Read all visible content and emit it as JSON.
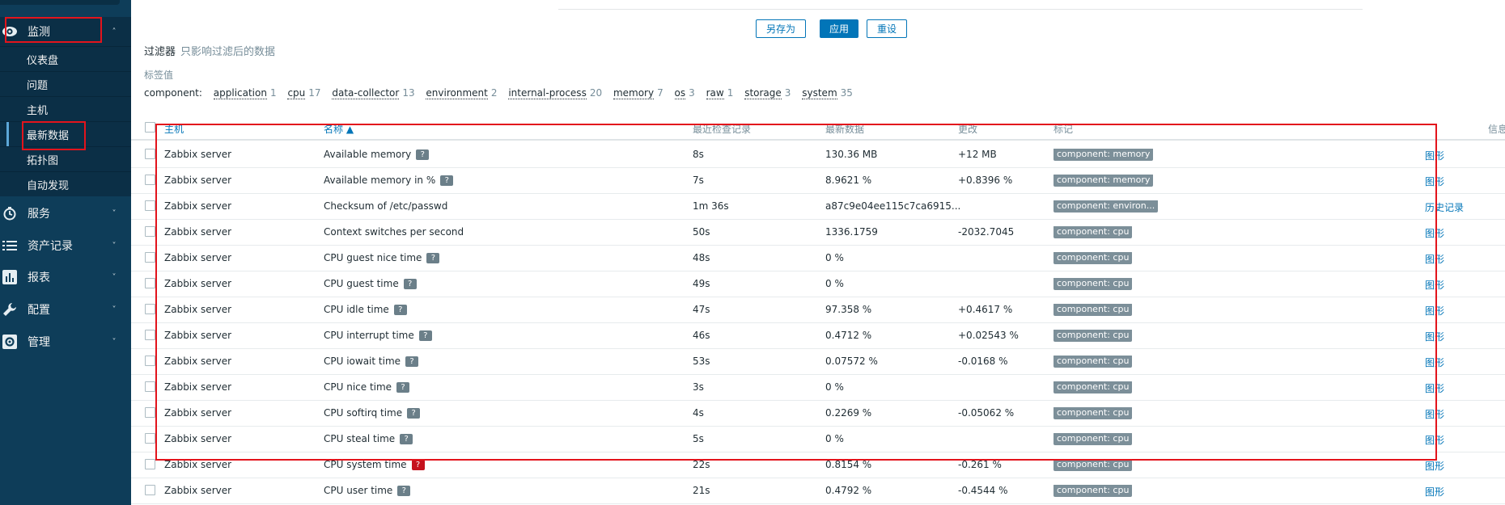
{
  "sidebar": {
    "items": [
      {
        "label": "监测",
        "icon": "eye-icon",
        "expanded": true
      },
      {
        "label": "服务",
        "icon": "clock-icon"
      },
      {
        "label": "资产记录",
        "icon": "list-icon"
      },
      {
        "label": "报表",
        "icon": "bar-chart-icon"
      },
      {
        "label": "配置",
        "icon": "wrench-icon"
      },
      {
        "label": "管理",
        "icon": "gear-icon"
      }
    ],
    "monitoring_submenu": [
      "仪表盘",
      "问题",
      "主机",
      "最新数据",
      "拓扑图",
      "自动发现"
    ]
  },
  "buttons": {
    "save_as": "另存为",
    "apply": "应用",
    "reset": "重设"
  },
  "filter": {
    "title": "过滤器",
    "note": "只影响过滤后的数据"
  },
  "tag_values": {
    "title": "标签值",
    "key": "component:",
    "tags": [
      {
        "name": "application",
        "count": "1"
      },
      {
        "name": "cpu",
        "count": "17"
      },
      {
        "name": "data-collector",
        "count": "13"
      },
      {
        "name": "environment",
        "count": "2"
      },
      {
        "name": "internal-process",
        "count": "20"
      },
      {
        "name": "memory",
        "count": "7"
      },
      {
        "name": "os",
        "count": "3"
      },
      {
        "name": "raw",
        "count": "1"
      },
      {
        "name": "storage",
        "count": "3"
      },
      {
        "name": "system",
        "count": "35"
      }
    ]
  },
  "table": {
    "headers": {
      "host": "主机",
      "name": "名称 ▲",
      "last_check": "最近检查记录",
      "last_value": "最新数据",
      "change": "更改",
      "tags": "标记",
      "info": "信息"
    },
    "rows": [
      {
        "host": "Zabbix server",
        "name": "Available memory",
        "help": true,
        "last_check": "8s",
        "last_value": "130.36 MB",
        "change": "+12 MB",
        "tag": "component: memory",
        "action": "图形"
      },
      {
        "host": "Zabbix server",
        "name": "Available memory in %",
        "help": true,
        "last_check": "7s",
        "last_value": "8.9621 %",
        "change": "+0.8396 %",
        "tag": "component: memory",
        "action": "图形"
      },
      {
        "host": "Zabbix server",
        "name": "Checksum of /etc/passwd",
        "help": false,
        "last_check": "1m 36s",
        "last_value": "a87c9e04ee115c7ca6915...",
        "change": "",
        "tag": "component: environ...",
        "action": "历史记录"
      },
      {
        "host": "Zabbix server",
        "name": "Context switches per second",
        "help": false,
        "last_check": "50s",
        "last_value": "1336.1759",
        "change": "-2032.7045",
        "tag": "component: cpu",
        "action": "图形"
      },
      {
        "host": "Zabbix server",
        "name": "CPU guest nice time",
        "help": true,
        "last_check": "48s",
        "last_value": "0 %",
        "change": "",
        "tag": "component: cpu",
        "action": "图形"
      },
      {
        "host": "Zabbix server",
        "name": "CPU guest time",
        "help": true,
        "last_check": "49s",
        "last_value": "0 %",
        "change": "",
        "tag": "component: cpu",
        "action": "图形"
      },
      {
        "host": "Zabbix server",
        "name": "CPU idle time",
        "help": true,
        "last_check": "47s",
        "last_value": "97.358 %",
        "change": "+0.4617 %",
        "tag": "component: cpu",
        "action": "图形"
      },
      {
        "host": "Zabbix server",
        "name": "CPU interrupt time",
        "help": true,
        "last_check": "46s",
        "last_value": "0.4712 %",
        "change": "+0.02543 %",
        "tag": "component: cpu",
        "action": "图形"
      },
      {
        "host": "Zabbix server",
        "name": "CPU iowait time",
        "help": true,
        "last_check": "53s",
        "last_value": "0.07572 %",
        "change": "-0.0168 %",
        "tag": "component: cpu",
        "action": "图形"
      },
      {
        "host": "Zabbix server",
        "name": "CPU nice time",
        "help": true,
        "last_check": "3s",
        "last_value": "0 %",
        "change": "",
        "tag": "component: cpu",
        "action": "图形"
      },
      {
        "host": "Zabbix server",
        "name": "CPU softirq time",
        "help": true,
        "last_check": "4s",
        "last_value": "0.2269 %",
        "change": "-0.05062 %",
        "tag": "component: cpu",
        "action": "图形"
      },
      {
        "host": "Zabbix server",
        "name": "CPU steal time",
        "help": true,
        "last_check": "5s",
        "last_value": "0 %",
        "change": "",
        "tag": "component: cpu",
        "action": "图形"
      },
      {
        "host": "Zabbix server",
        "name": "CPU system time",
        "help": true,
        "help_red": true,
        "last_check": "22s",
        "last_value": "0.8154 %",
        "change": "-0.261 %",
        "tag": "component: cpu",
        "action": "图形"
      },
      {
        "host": "Zabbix server",
        "name": "CPU user time",
        "help": true,
        "last_check": "21s",
        "last_value": "0.4792 %",
        "change": "-0.4544 %",
        "tag": "component: cpu",
        "action": "图形"
      }
    ]
  },
  "colors": {
    "sidebar_bg": "#0e3d59",
    "accent": "#0275b8",
    "highlight_red": "#e3141c",
    "tag_bg": "#7c8f99"
  }
}
